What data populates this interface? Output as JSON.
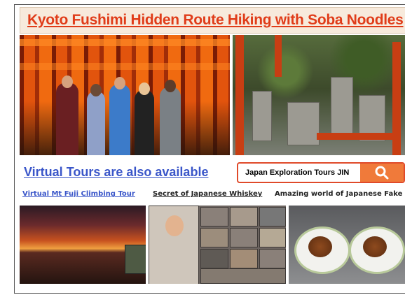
{
  "title": "Kyoto Fushimi Hidden Route Hiking with Soba Noodles",
  "colors": {
    "title": "#e03c19",
    "link_blue": "#3a56c9",
    "search_border": "#e04a2a",
    "search_button": "#f07a3a"
  },
  "photos": {
    "hikers": "torii-gates-hikers-photo",
    "shrine": "moss-shrine-photo",
    "sunset": "mt-fuji-sunset-photo",
    "videocall": "whiskey-video-call-photo",
    "food": "fake-food-burger-photo"
  },
  "virtual_title": "Virtual Tours are also available",
  "search": {
    "text": "Japan Exploration Tours JIN",
    "icon": "search-icon"
  },
  "tours": [
    {
      "label": "Virtual Mt Fuji Climbing Tour"
    },
    {
      "label": "Secret of Japanese Whiskey"
    },
    {
      "label": "Amazing world of Japanese Fake Foo"
    }
  ]
}
